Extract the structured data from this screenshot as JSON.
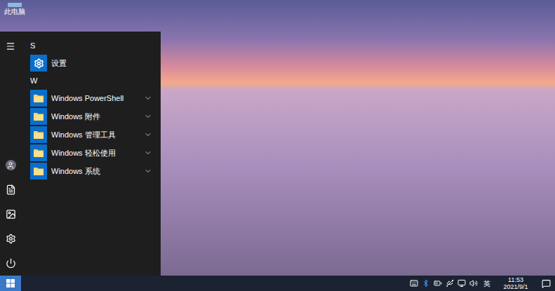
{
  "desktop": {
    "icons": [
      {
        "label": "此电脑"
      }
    ]
  },
  "start_menu": {
    "groups": [
      {
        "letter": "S",
        "items": [
          {
            "label": "设置",
            "kind": "app"
          }
        ]
      },
      {
        "letter": "W",
        "items": [
          {
            "label": "Windows PowerShell",
            "kind": "folder",
            "expanded": false
          },
          {
            "label": "Windows 附件",
            "kind": "folder",
            "expanded": false
          },
          {
            "label": "Windows 管理工具",
            "kind": "folder",
            "expanded": false
          },
          {
            "label": "Windows 轻松使用",
            "kind": "folder",
            "expanded": false
          },
          {
            "label": "Windows 系统",
            "kind": "folder",
            "expanded": false
          }
        ]
      }
    ]
  },
  "taskbar": {
    "start_button": {
      "selected": true
    },
    "tray": {
      "input_method": "英",
      "time": "11:53",
      "date": "2021/9/1"
    }
  }
}
